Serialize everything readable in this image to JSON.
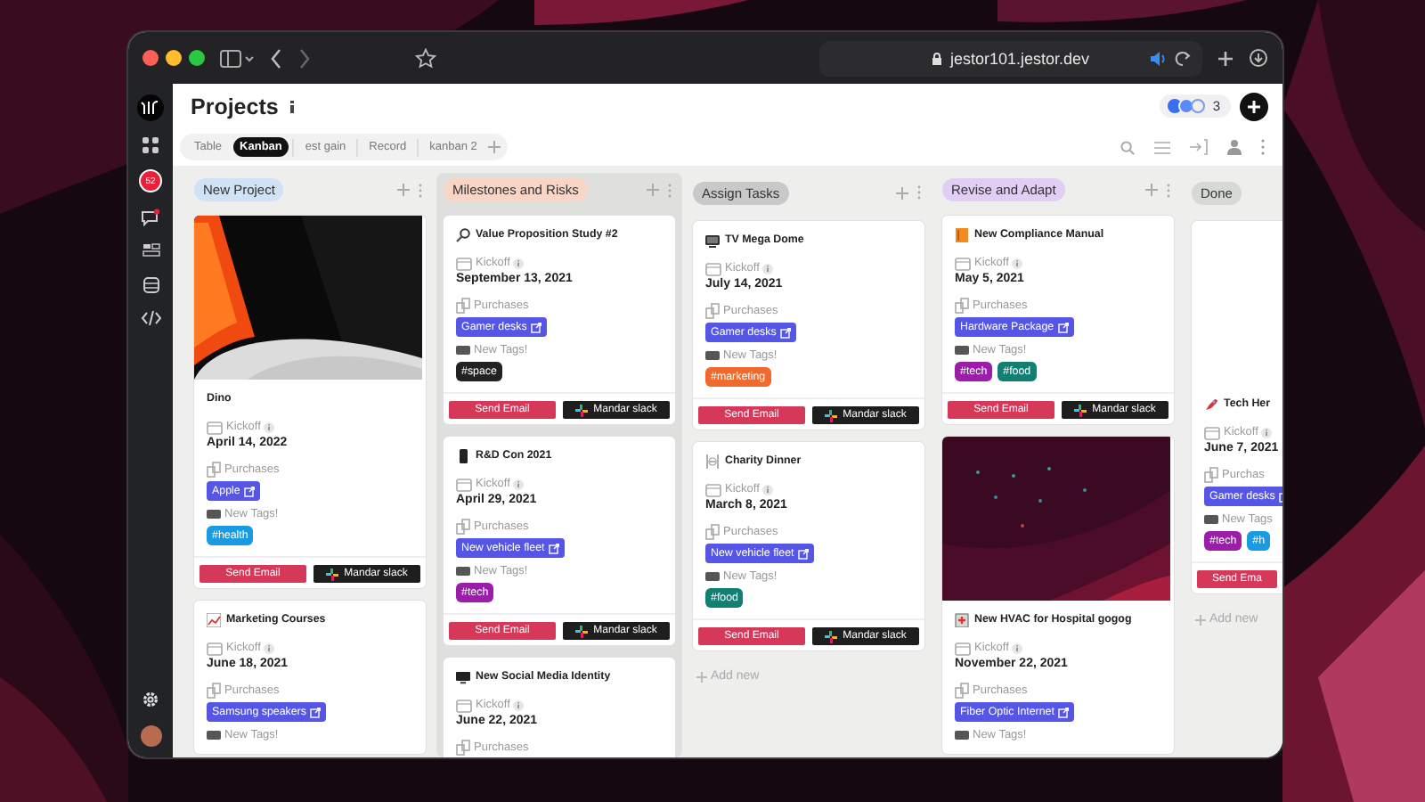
{
  "browser": {
    "url": "jestor101.jestor.dev"
  },
  "sidebar": {
    "badge": "52"
  },
  "page": {
    "title": "Projects",
    "collaborator_count": "3"
  },
  "views": [
    {
      "label": "Table",
      "selected": false
    },
    {
      "label": "Kanban",
      "selected": true
    },
    {
      "label": "est gain",
      "selected": false
    },
    {
      "label": "Record",
      "selected": false
    },
    {
      "label": "kanban 2",
      "selected": false
    }
  ],
  "columns": [
    {
      "name": "New Project",
      "color": "#cfe2f6",
      "highlighted": false,
      "cards": [
        {
          "kind": "cover",
          "title": "Dino",
          "kickoff_label": "Kickoff",
          "kickoff": "April 14, 2022",
          "purchases_label": "Purchases",
          "purchases": [
            "Apple"
          ],
          "tags_label": "New Tags!",
          "tags": [
            {
              "label": "#health",
              "color": "#1a9ae0"
            }
          ],
          "actions": [
            "Send Email",
            "Mandar slack"
          ]
        },
        {
          "kind": "plain",
          "title": "Marketing Courses",
          "kickoff_label": "Kickoff",
          "kickoff": "June 18, 2021",
          "purchases_label": "Purchases",
          "purchases": [
            "Samsung speakers"
          ],
          "tags_label": "New Tags!"
        }
      ]
    },
    {
      "name": "Milestones and Risks",
      "color": "#f8d5c4",
      "highlighted": true,
      "cards": [
        {
          "kind": "plain",
          "title": "Value Proposition Study #2",
          "kickoff_label": "Kickoff",
          "kickoff": "September 13, 2021",
          "purchases_label": "Purchases",
          "purchases": [
            "Gamer desks"
          ],
          "tags_label": "New Tags!",
          "tags": [
            {
              "label": "#space",
              "color": "#222222"
            }
          ],
          "actions": [
            "Send Email",
            "Mandar slack"
          ]
        },
        {
          "kind": "plain",
          "title": "R&D Con 2021",
          "kickoff_label": "Kickoff",
          "kickoff": "April 29, 2021",
          "purchases_label": "Purchases",
          "purchases": [
            "New vehicle fleet"
          ],
          "tags_label": "New Tags!",
          "tags": [
            {
              "label": "#tech",
              "color": "#9a1ea8"
            }
          ],
          "actions": [
            "Send Email",
            "Mandar slack"
          ]
        },
        {
          "kind": "plain",
          "title": "New Social Media Identity",
          "kickoff_label": "Kickoff",
          "kickoff": "June 22, 2021",
          "purchases_label": "Purchases"
        }
      ]
    },
    {
      "name": "Assign Tasks",
      "color": "#c9c9c9",
      "highlighted": false,
      "add_new": "Add new",
      "cards": [
        {
          "kind": "plain",
          "title": "TV Mega Dome",
          "kickoff_label": "Kickoff",
          "kickoff": "July 14, 2021",
          "purchases_label": "Purchases",
          "purchases": [
            "Gamer desks"
          ],
          "tags_label": "New Tags!",
          "tags": [
            {
              "label": "#marketing",
              "color": "#ef6a2c"
            }
          ],
          "actions": [
            "Send Email",
            "Mandar slack"
          ]
        },
        {
          "kind": "plain",
          "title": "Charity Dinner",
          "kickoff_label": "Kickoff",
          "kickoff": "March 8, 2021",
          "purchases_label": "Purchases",
          "purchases": [
            "New vehicle fleet"
          ],
          "tags_label": "New Tags!",
          "tags": [
            {
              "label": "#food",
              "color": "#137f72"
            }
          ],
          "actions": [
            "Send Email",
            "Mandar slack"
          ]
        }
      ]
    },
    {
      "name": "Revise and Adapt",
      "color": "#e2cdf4",
      "highlighted": false,
      "cards": [
        {
          "kind": "plain",
          "title": "New Compliance Manual",
          "kickoff_label": "Kickoff",
          "kickoff": "May 5, 2021",
          "purchases_label": "Purchases",
          "purchases": [
            "Hardware Package"
          ],
          "tags_label": "New Tags!",
          "tags": [
            {
              "label": "#tech",
              "color": "#9a1ea8"
            },
            {
              "label": "#food",
              "color": "#137f72"
            }
          ],
          "actions": [
            "Send Email",
            "Mandar slack"
          ]
        },
        {
          "kind": "cover",
          "title": "New HVAC for Hospital gogog",
          "kickoff_label": "Kickoff",
          "kickoff": "November 22, 2021",
          "purchases_label": "Purchases",
          "purchases": [
            "Fiber Optic Internet"
          ],
          "tags_label": "New Tags!"
        }
      ]
    },
    {
      "name": "Done",
      "color": "#d6d9d6",
      "highlighted": false,
      "add_new": "Add new",
      "cards": [
        {
          "kind": "blank",
          "title": "Tech Her",
          "kickoff_label": "Kickoff",
          "kickoff": "June 7, 2021",
          "purchases_label": "Purchas",
          "purchases": [
            "Gamer desks"
          ],
          "tags_label": "New Tags",
          "tags": [
            {
              "label": "#tech",
              "color": "#9a1ea8"
            },
            {
              "label": "#h",
              "color": "#1a9ae0"
            }
          ],
          "actions": [
            "Send Ema"
          ]
        }
      ]
    }
  ]
}
